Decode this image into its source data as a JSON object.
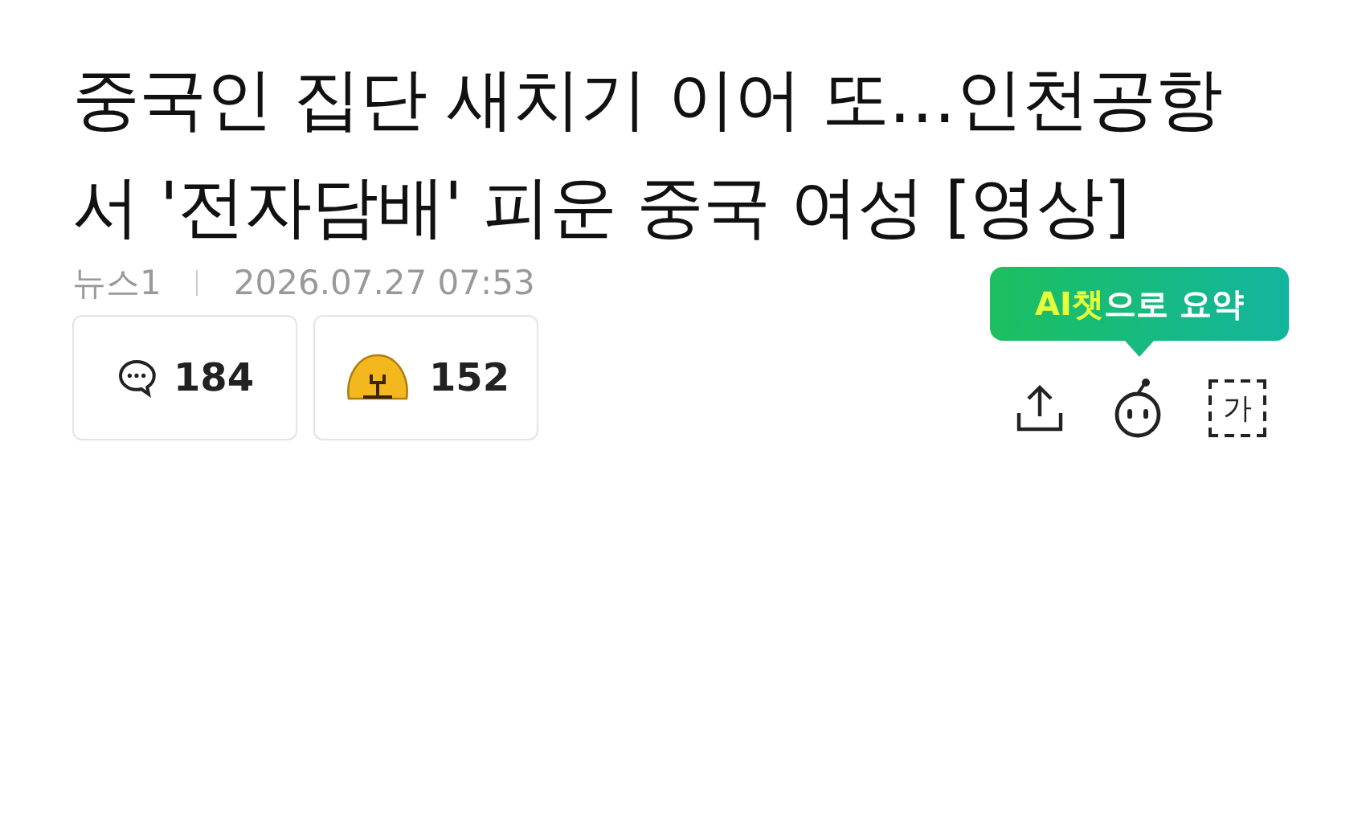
{
  "headline": "중국인 집단 새치기 이어 또…인천공항서 '전자담배' 피운 중국 여성 [영상]",
  "meta": {
    "source": "뉴스1",
    "datetime": "2026.07.27 07:53"
  },
  "reactions": [
    {
      "kind": "comment",
      "count": "184"
    },
    {
      "kind": "emoji",
      "count": "152"
    }
  ],
  "tooltip": {
    "highlight": "AI챗",
    "text": "으로 요약"
  },
  "font_icon_glyph": "가"
}
